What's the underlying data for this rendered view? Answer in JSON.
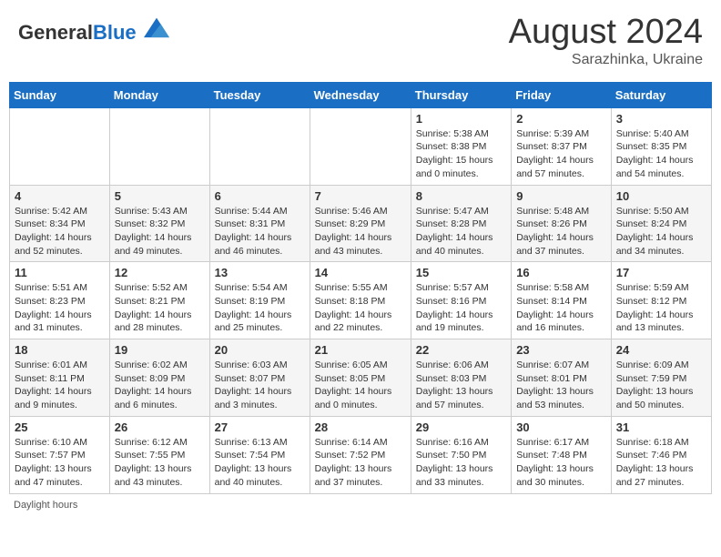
{
  "header": {
    "logo": {
      "general": "General",
      "blue": "Blue"
    },
    "month_year": "August 2024",
    "location": "Sarazhinka, Ukraine"
  },
  "weekdays": [
    "Sunday",
    "Monday",
    "Tuesday",
    "Wednesday",
    "Thursday",
    "Friday",
    "Saturday"
  ],
  "weeks": [
    [
      null,
      null,
      null,
      null,
      {
        "day": 1,
        "sunrise": "5:38 AM",
        "sunset": "8:38 PM",
        "daylight": "15 hours and 0 minutes."
      },
      {
        "day": 2,
        "sunrise": "5:39 AM",
        "sunset": "8:37 PM",
        "daylight": "14 hours and 57 minutes."
      },
      {
        "day": 3,
        "sunrise": "5:40 AM",
        "sunset": "8:35 PM",
        "daylight": "14 hours and 54 minutes."
      }
    ],
    [
      {
        "day": 4,
        "sunrise": "5:42 AM",
        "sunset": "8:34 PM",
        "daylight": "14 hours and 52 minutes."
      },
      {
        "day": 5,
        "sunrise": "5:43 AM",
        "sunset": "8:32 PM",
        "daylight": "14 hours and 49 minutes."
      },
      {
        "day": 6,
        "sunrise": "5:44 AM",
        "sunset": "8:31 PM",
        "daylight": "14 hours and 46 minutes."
      },
      {
        "day": 7,
        "sunrise": "5:46 AM",
        "sunset": "8:29 PM",
        "daylight": "14 hours and 43 minutes."
      },
      {
        "day": 8,
        "sunrise": "5:47 AM",
        "sunset": "8:28 PM",
        "daylight": "14 hours and 40 minutes."
      },
      {
        "day": 9,
        "sunrise": "5:48 AM",
        "sunset": "8:26 PM",
        "daylight": "14 hours and 37 minutes."
      },
      {
        "day": 10,
        "sunrise": "5:50 AM",
        "sunset": "8:24 PM",
        "daylight": "14 hours and 34 minutes."
      }
    ],
    [
      {
        "day": 11,
        "sunrise": "5:51 AM",
        "sunset": "8:23 PM",
        "daylight": "14 hours and 31 minutes."
      },
      {
        "day": 12,
        "sunrise": "5:52 AM",
        "sunset": "8:21 PM",
        "daylight": "14 hours and 28 minutes."
      },
      {
        "day": 13,
        "sunrise": "5:54 AM",
        "sunset": "8:19 PM",
        "daylight": "14 hours and 25 minutes."
      },
      {
        "day": 14,
        "sunrise": "5:55 AM",
        "sunset": "8:18 PM",
        "daylight": "14 hours and 22 minutes."
      },
      {
        "day": 15,
        "sunrise": "5:57 AM",
        "sunset": "8:16 PM",
        "daylight": "14 hours and 19 minutes."
      },
      {
        "day": 16,
        "sunrise": "5:58 AM",
        "sunset": "8:14 PM",
        "daylight": "14 hours and 16 minutes."
      },
      {
        "day": 17,
        "sunrise": "5:59 AM",
        "sunset": "8:12 PM",
        "daylight": "14 hours and 13 minutes."
      }
    ],
    [
      {
        "day": 18,
        "sunrise": "6:01 AM",
        "sunset": "8:11 PM",
        "daylight": "14 hours and 9 minutes."
      },
      {
        "day": 19,
        "sunrise": "6:02 AM",
        "sunset": "8:09 PM",
        "daylight": "14 hours and 6 minutes."
      },
      {
        "day": 20,
        "sunrise": "6:03 AM",
        "sunset": "8:07 PM",
        "daylight": "14 hours and 3 minutes."
      },
      {
        "day": 21,
        "sunrise": "6:05 AM",
        "sunset": "8:05 PM",
        "daylight": "14 hours and 0 minutes."
      },
      {
        "day": 22,
        "sunrise": "6:06 AM",
        "sunset": "8:03 PM",
        "daylight": "13 hours and 57 minutes."
      },
      {
        "day": 23,
        "sunrise": "6:07 AM",
        "sunset": "8:01 PM",
        "daylight": "13 hours and 53 minutes."
      },
      {
        "day": 24,
        "sunrise": "6:09 AM",
        "sunset": "7:59 PM",
        "daylight": "13 hours and 50 minutes."
      }
    ],
    [
      {
        "day": 25,
        "sunrise": "6:10 AM",
        "sunset": "7:57 PM",
        "daylight": "13 hours and 47 minutes."
      },
      {
        "day": 26,
        "sunrise": "6:12 AM",
        "sunset": "7:55 PM",
        "daylight": "13 hours and 43 minutes."
      },
      {
        "day": 27,
        "sunrise": "6:13 AM",
        "sunset": "7:54 PM",
        "daylight": "13 hours and 40 minutes."
      },
      {
        "day": 28,
        "sunrise": "6:14 AM",
        "sunset": "7:52 PM",
        "daylight": "13 hours and 37 minutes."
      },
      {
        "day": 29,
        "sunrise": "6:16 AM",
        "sunset": "7:50 PM",
        "daylight": "13 hours and 33 minutes."
      },
      {
        "day": 30,
        "sunrise": "6:17 AM",
        "sunset": "7:48 PM",
        "daylight": "13 hours and 30 minutes."
      },
      {
        "day": 31,
        "sunrise": "6:18 AM",
        "sunset": "7:46 PM",
        "daylight": "13 hours and 27 minutes."
      }
    ]
  ],
  "footer": {
    "daylight_hours_label": "Daylight hours"
  }
}
